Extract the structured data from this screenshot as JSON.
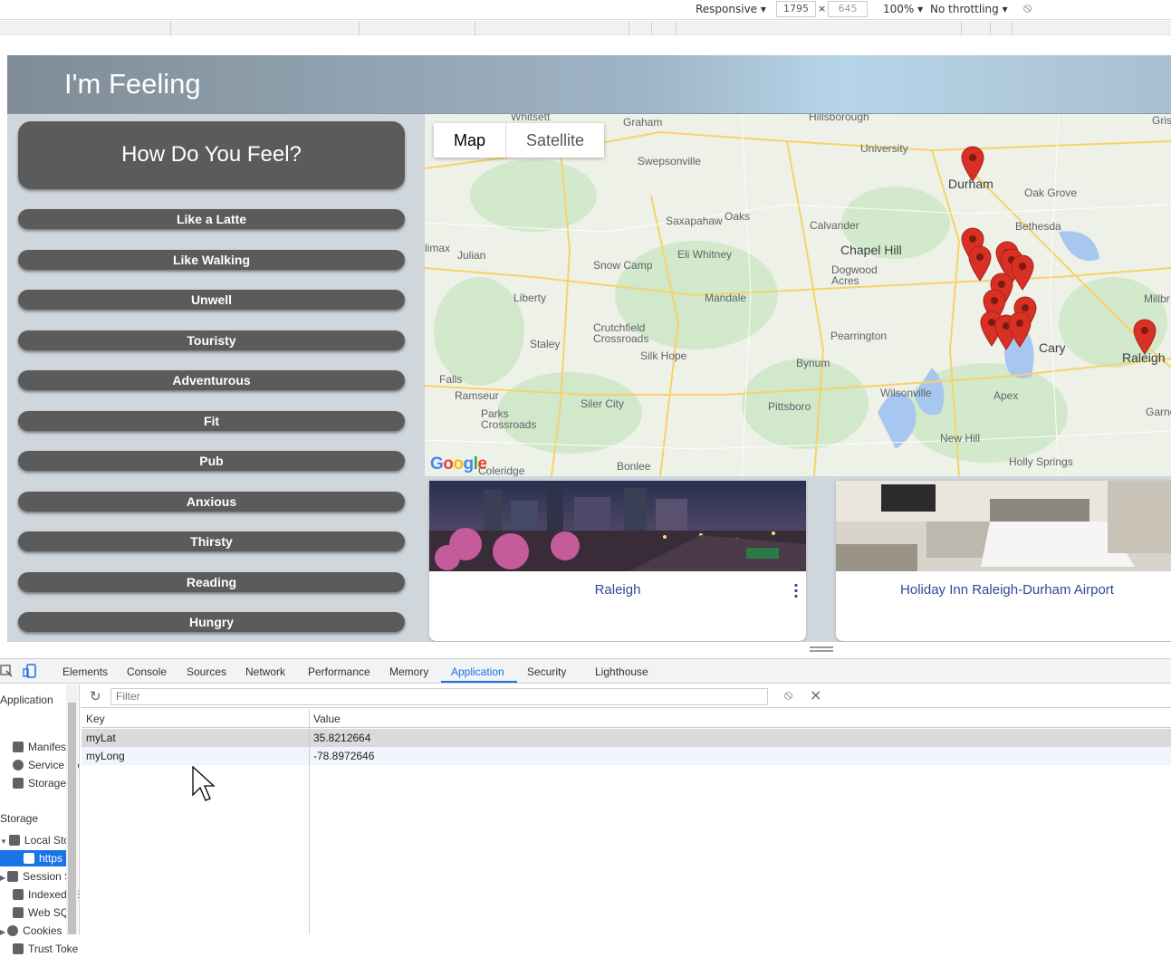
{
  "device_toolbar": {
    "mode": "Responsive",
    "width": "1795",
    "height": "645",
    "zoom": "100%",
    "throttling": "No throttling"
  },
  "app": {
    "title": "I'm Feeling",
    "prompt": "How Do You Feel?",
    "moods": [
      "Like a Latte",
      "Like Walking",
      "Unwell",
      "Touristy",
      "Adventurous",
      "Fit",
      "Pub",
      "Anxious",
      "Thirsty",
      "Reading",
      "Hungry"
    ]
  },
  "map": {
    "toggle": [
      "Map",
      "Satellite"
    ],
    "active_toggle": "Map",
    "logo": "Google",
    "labels": [
      "Whitsett",
      "Graham",
      "Hillsborough",
      "Swepsonville",
      "University",
      "Durham",
      "Oak Grove",
      "Saxapahaw",
      "Oaks",
      "Calvander",
      "Bethesda",
      "Julian",
      "Eli Whitney",
      "Chapel Hill",
      "Snow Camp",
      "Dogwood Acres",
      "Liberty",
      "Mandale",
      "Crutchfield Crossroads",
      "Staley",
      "Silk Hope",
      "Pearrington",
      "Cary",
      "Raleigh",
      "Bynum",
      "Ramseur",
      "Siler City",
      "Wilsonville",
      "Apex",
      "Parks Crossroads",
      "Pittsboro",
      "New Hill",
      "Falls",
      "Coleridge",
      "Bonlee",
      "Holly Springs",
      "Garne",
      "Millbr",
      "Gris",
      "limax"
    ],
    "marker_color": "#d93025"
  },
  "cards": [
    {
      "title": "Raleigh"
    },
    {
      "title": "Holiday Inn Raleigh-Durham Airport"
    }
  ],
  "devtools": {
    "tabs": [
      "Elements",
      "Console",
      "Sources",
      "Network",
      "Performance",
      "Memory",
      "Application",
      "Security",
      "Lighthouse"
    ],
    "active_tab": "Application",
    "sidebar": {
      "application_header": "Application",
      "application_items": [
        "Manifest",
        "Service Workers",
        "Storage"
      ],
      "storage_header": "Storage",
      "storage_items": [
        "Local Storage",
        "https",
        "Session Storage",
        "IndexedDB",
        "Web SQL",
        "Cookies",
        "Trust Tokens"
      ]
    },
    "filter_placeholder": "Filter",
    "columns": [
      "Key",
      "Value"
    ],
    "rows": [
      {
        "key": "myLat",
        "value": "35.8212664"
      },
      {
        "key": "myLong",
        "value": "-78.8972646"
      }
    ]
  }
}
